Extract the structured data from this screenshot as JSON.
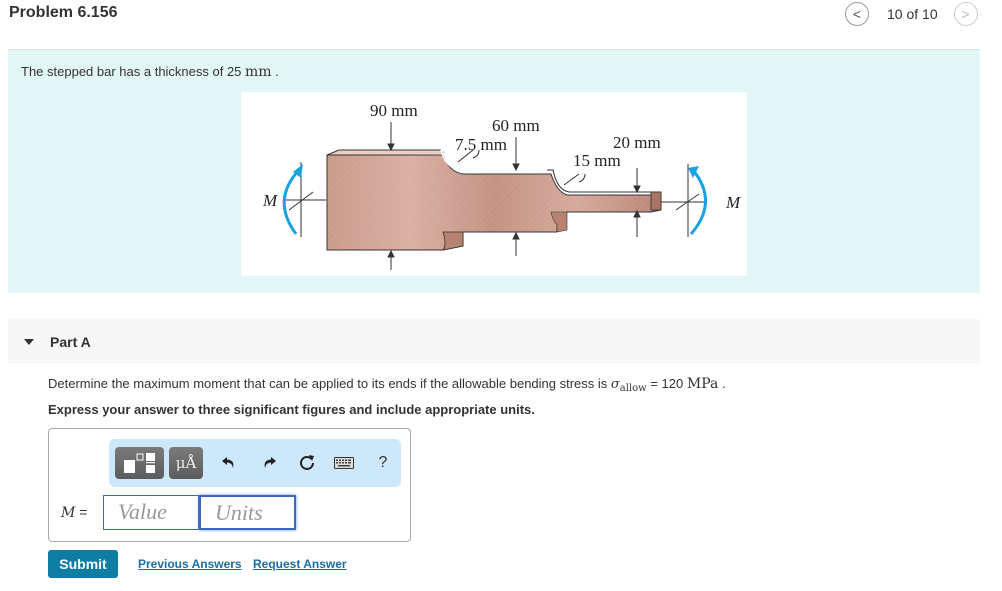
{
  "header": {
    "title": "Problem 6.156",
    "pager": {
      "prev_icon": "chevron-left-icon",
      "next_icon": "chevron-right-icon",
      "position": "10 of 10",
      "prev_glyph": "<",
      "next_glyph": ">"
    }
  },
  "intro": {
    "text_before": "The stepped bar has a thickness of 25 ",
    "unit": "mm",
    "text_after": " .",
    "figure": {
      "labels": {
        "dim_90": "90 mm",
        "dim_60": "60 mm",
        "dim_7_5": "7.5 mm",
        "dim_20": "20 mm",
        "dim_15": "15 mm",
        "moment_left": "M",
        "moment_right": "M"
      },
      "colors": {
        "bar": "#c99a8a",
        "bar_light": "#e7c7ba",
        "bar_dark": "#a87566",
        "moment_arrow": "#1aa3e0"
      }
    }
  },
  "part": {
    "label": "Part A",
    "question_before": "Determine the maximum moment that can be applied to its ends if the allowable bending stress is ",
    "sigma": "σ",
    "sigma_sub": "allow",
    "equals": " = 120 ",
    "stress_unit": "MPa",
    "question_after": " .",
    "instruction": "Express your answer to three significant figures and include appropriate units.",
    "toolbar": {
      "templates_icon": "templates-icon",
      "units_label": "μÅ",
      "undo_icon": "undo-icon",
      "redo_icon": "redo-icon",
      "reset_icon": "reset-icon",
      "keyboard_icon": "keyboard-icon",
      "help_label": "?"
    },
    "answer": {
      "variable": "M",
      "equals": " =",
      "value_placeholder": "Value",
      "units_placeholder": "Units",
      "value": "",
      "units": ""
    },
    "submit_label": "Submit",
    "previous_answers_label": "Previous Answers",
    "request_answer_label": "Request Answer"
  },
  "colors": {
    "intro_bg": "#e3f6f6",
    "part_header_bg": "#f7f7f7",
    "toolbar_bg": "#cde8fb",
    "submit_bg": "#0d7da4",
    "link": "#1a6ea8",
    "field_border": "#3c66c4"
  }
}
